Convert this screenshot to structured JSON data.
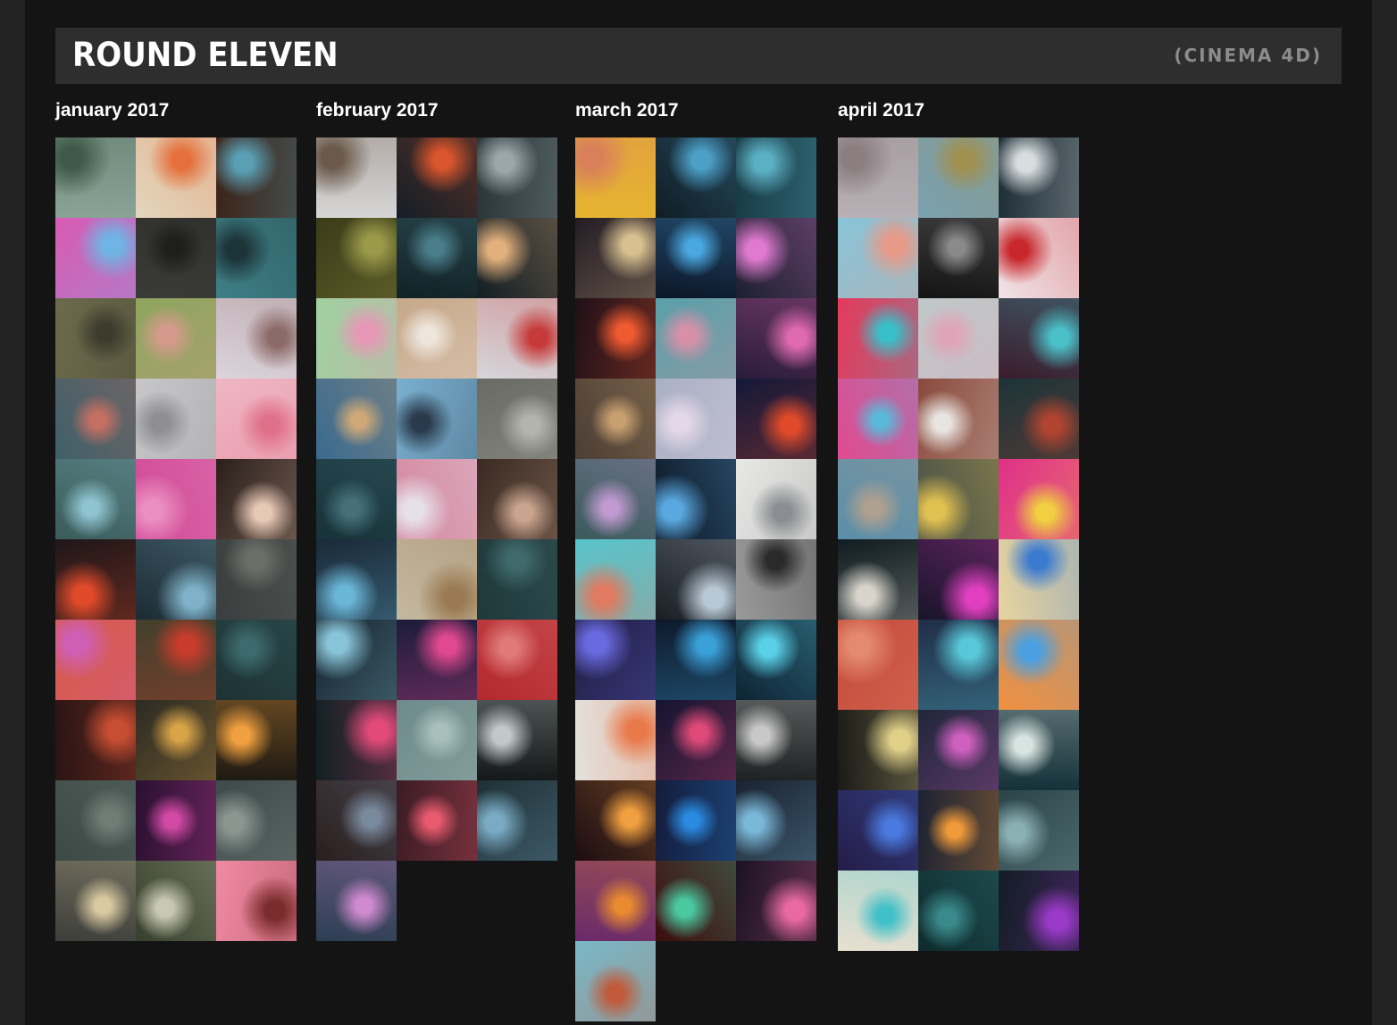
{
  "header": {
    "title": "ROUND ELEVEN",
    "subtitle": "(CINEMA 4D)"
  },
  "months": [
    {
      "label": "january 2017",
      "tiles": [
        [
          "#8aa397",
          "#3f5a48"
        ],
        [
          "#e3d6bd",
          "#e5703c"
        ],
        [
          "#3b2216",
          "#5a9fb4"
        ],
        [
          "#d95ab4",
          "#6fb4e4"
        ],
        [
          "#3a3a36",
          "#1e1e1c"
        ],
        [
          "#3e7f86",
          "#1c3337"
        ],
        [
          "#6b6a4c",
          "#3d3b2c"
        ],
        [
          "#8ea55e",
          "#d69a8c"
        ],
        [
          "#dcd4dc",
          "#8c6a68"
        ],
        [
          "#3f5f68",
          "#c56f63"
        ],
        [
          "#c7c7c9",
          "#8f8f92"
        ],
        [
          "#efb6c3",
          "#e0708a"
        ],
        [
          "#3a5c5a",
          "#8ec3cf"
        ],
        [
          "#d04b96",
          "#eb8ec2"
        ],
        [
          "#2b1f1a",
          "#e7c7b5"
        ],
        [
          "#1f1719",
          "#e04a2a"
        ],
        [
          "#1c2b33",
          "#7fb2c9"
        ],
        [
          "#3a3e3e",
          "#6a7068"
        ],
        [
          "#d75a45",
          "#cf5fb4"
        ],
        [
          "#42402c",
          "#c73c2c"
        ],
        [
          "#1d3234",
          "#3d6a6c"
        ],
        [
          "#2a1414",
          "#c84e32"
        ],
        [
          "#2c2a22",
          "#d9a448"
        ],
        [
          "#1e1a12",
          "#f0a040"
        ],
        [
          "#3c4a46",
          "#6e7e76"
        ],
        [
          "#2a1030",
          "#d24aa6"
        ],
        [
          "#3e4a4a",
          "#8b9690"
        ],
        [
          "#3c3e3a",
          "#d9c9a0"
        ],
        [
          "#36402c",
          "#c8c8b4"
        ],
        [
          "#f08aa4",
          "#7a2c2c"
        ]
      ]
    },
    {
      "label": "february 2017",
      "tiles": [
        [
          "#d6d6d6",
          "#6b5a4c"
        ],
        [
          "#141e26",
          "#d9552c"
        ],
        [
          "#283438",
          "#9aa8ac"
        ],
        [
          "#3b3b18",
          "#9a9a4a"
        ],
        [
          "#122226",
          "#4a7e8a"
        ],
        [
          "#141e24",
          "#e2b07c"
        ],
        [
          "#a0d0a0",
          "#e897b6"
        ],
        [
          "#c7a88a",
          "#eee6dc"
        ],
        [
          "#d6d6da",
          "#c63a3a"
        ],
        [
          "#3a6a8e",
          "#d0a878"
        ],
        [
          "#7ab0d0",
          "#2a3a4c"
        ],
        [
          "#6a6a64",
          "#b4b4ae"
        ],
        [
          "#173238",
          "#45707a"
        ],
        [
          "#d488a0",
          "#e6e0e8"
        ],
        [
          "#3a2a22",
          "#c9a48e"
        ],
        [
          "#1a2a38",
          "#6ab6d8"
        ],
        [
          "#c4b8a0",
          "#9a7a52"
        ],
        [
          "#20383a",
          "#3f6a6c"
        ],
        [
          "#14222c",
          "#88c4d8"
        ],
        [
          "#1c1c3a",
          "#e04890"
        ],
        [
          "#b4282c",
          "#e07a7a"
        ],
        [
          "#122024",
          "#e24a7a"
        ],
        [
          "#6e8a8a",
          "#a8c0bc"
        ],
        [
          "#141818",
          "#c0c8ca"
        ],
        [
          "#2a1e1e",
          "#7a8a9e"
        ],
        [
          "#3c1c24",
          "#e85a6e"
        ],
        [
          "#1e3036",
          "#7aaac4"
        ],
        [
          "#2c3e52",
          "#d08ad0"
        ]
      ]
    },
    {
      "label": "march 2017",
      "tiles": [
        [
          "#e6b430",
          "#d9805a"
        ],
        [
          "#101c24",
          "#4ca0c8"
        ],
        [
          "#173a44",
          "#5cb0c4"
        ],
        [
          "#241c24",
          "#d8c090"
        ],
        [
          "#0c1628",
          "#4aa8e0"
        ],
        [
          "#1c2030",
          "#e07ad0"
        ],
        [
          "#201018",
          "#f05a30"
        ],
        [
          "#5aa0a8",
          "#d890a8"
        ],
        [
          "#2a1c3a",
          "#e06ab0"
        ],
        [
          "#4c3e34",
          "#c8a070"
        ],
        [
          "#aab0c4",
          "#e4d8e8"
        ],
        [
          "#141838",
          "#e04a2a"
        ],
        [
          "#3a5a5c",
          "#c09ad0"
        ],
        [
          "#0c1624",
          "#5aa8e0"
        ],
        [
          "#e8e8e4",
          "#8a8e92"
        ],
        [
          "#58c4cc",
          "#e07a60"
        ],
        [
          "#1a1e24",
          "#b8c8d4"
        ],
        [
          "#9a9a9a",
          "#2a2a2a"
        ],
        [
          "#1e1c40",
          "#6a6ae0"
        ],
        [
          "#0e1a2c",
          "#3aa0d8"
        ],
        [
          "#0e2434",
          "#5ad0e8"
        ],
        [
          "#e4e0dc",
          "#e87a4a"
        ],
        [
          "#141430",
          "#e04a7a"
        ],
        [
          "#1e2222",
          "#c8c8c8"
        ],
        [
          "#1c0c12",
          "#f0a040"
        ],
        [
          "#141c3c",
          "#2a8ae0"
        ],
        [
          "#1a2230",
          "#7ab8d8"
        ],
        [
          "#6a2a6a",
          "#e88a30"
        ],
        [
          "#3c0c0c",
          "#4ac8a0"
        ],
        [
          "#1a1222",
          "#e86aa0"
        ],
        [
          "#7ab8c8",
          "#c05a3a"
        ]
      ]
    },
    {
      "label": "april 2017",
      "tiles": [
        [
          "#b8b0b4",
          "#8a7e80"
        ],
        [
          "#7aa0b0",
          "#a09050"
        ],
        [
          "#1c2c34",
          "#d8dde0"
        ],
        [
          "#88c4d8",
          "#e89a88"
        ],
        [
          "#141414",
          "#8a8a8a"
        ],
        [
          "#f0e4e8",
          "#c8282c"
        ],
        [
          "#e43a5c",
          "#38c0c8"
        ],
        [
          "#c0c8c8",
          "#e0a4b8"
        ],
        [
          "#3a1c2c",
          "#4ac0c8"
        ],
        [
          "#e04a90",
          "#5ab8d8"
        ],
        [
          "#8a4a3c",
          "#e8e4e0"
        ],
        [
          "#1c3438",
          "#b04430"
        ],
        [
          "#5a8ea8",
          "#b0a090"
        ],
        [
          "#485048",
          "#e0c050"
        ],
        [
          "#e0308a",
          "#f0d040"
        ],
        [
          "#101c20",
          "#d8d4cc"
        ],
        [
          "#18142a",
          "#e040c0"
        ],
        [
          "#e8d4a0",
          "#3a7ad0"
        ],
        [
          "#c44a3a",
          "#e48a70"
        ],
        [
          "#202e48",
          "#58c8d8"
        ],
        [
          "#f09040",
          "#4aa0e0"
        ],
        [
          "#1a1a18",
          "#e0d088"
        ],
        [
          "#20263a",
          "#d060c0"
        ],
        [
          "#143038",
          "#d8e4e0"
        ],
        [
          "#241c48",
          "#4a7ae0"
        ],
        [
          "#1c2232",
          "#f09a3a"
        ],
        [
          "#2c4448",
          "#8ab0b4"
        ],
        [
          "#e8e0d0",
          "#40c0c8"
        ],
        [
          "#0e2a2c",
          "#3a8a8c"
        ],
        [
          "#121c24",
          "#9a3ac8"
        ]
      ]
    }
  ]
}
